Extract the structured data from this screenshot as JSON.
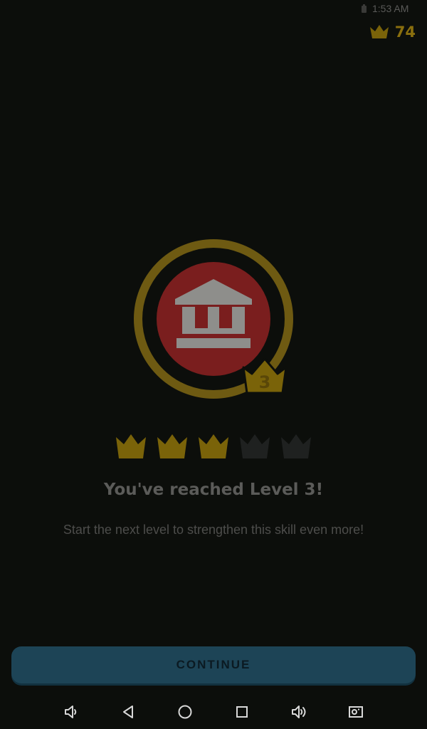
{
  "status_bar": {
    "time": "1:53 AM",
    "battery_icon": "battery-icon"
  },
  "header": {
    "crown_count": "74",
    "crown_icon": "crown-icon"
  },
  "skill": {
    "icon": "building-icon",
    "level_number": "3",
    "ring_color": "#6e5a12",
    "inner_color": "#7a1e1e"
  },
  "level_progress": {
    "reached": 3,
    "total": 5,
    "filled_color": "#7a6309",
    "empty_color": "#1f2120"
  },
  "content": {
    "title": "You've reached Level 3!",
    "subtitle": "Start the next level to strengthen this skill even more!"
  },
  "actions": {
    "continue_label": "CONTINUE"
  },
  "nav": [
    "volume-down-icon",
    "back-icon",
    "home-icon",
    "recents-icon",
    "volume-up-icon",
    "screenshot-icon"
  ]
}
